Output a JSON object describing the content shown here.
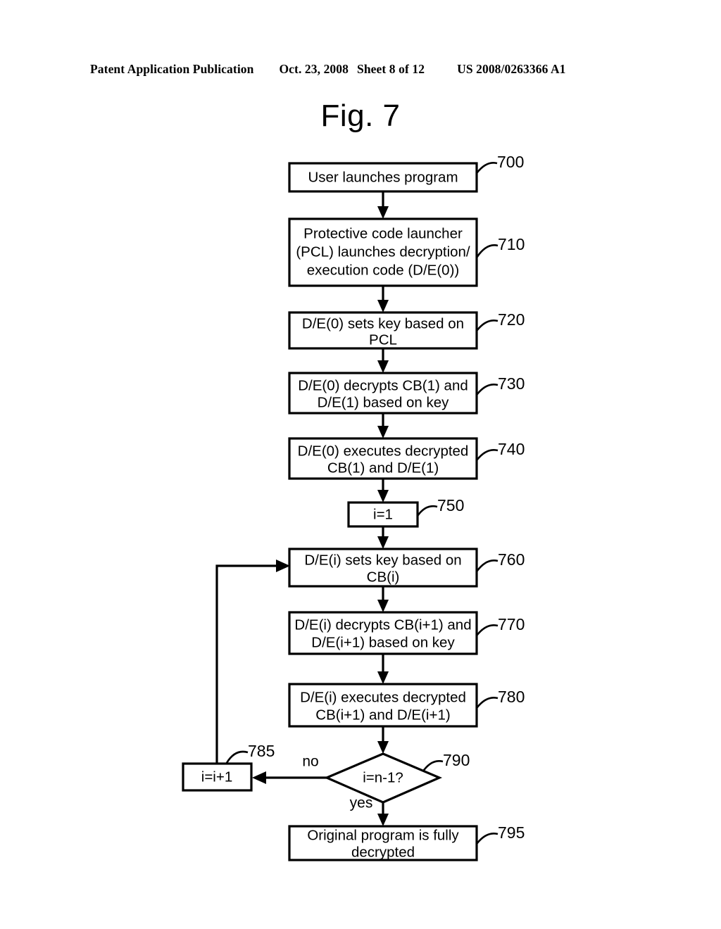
{
  "header": {
    "publication": "Patent Application Publication",
    "date": "Oct. 23, 2008",
    "sheet": "Sheet 8 of 12",
    "patent_number": "US 2008/0263366 A1"
  },
  "figure": {
    "title": "Fig. 7",
    "type": "flowchart"
  },
  "flowchart": {
    "nodes": [
      {
        "id": "700",
        "ref": "700",
        "shape": "rect",
        "lines": [
          "User launches program"
        ]
      },
      {
        "id": "710",
        "ref": "710",
        "shape": "rect",
        "lines": [
          "Protective code launcher",
          "(PCL) launches decryption/",
          "execution code (D/E(0))"
        ]
      },
      {
        "id": "720",
        "ref": "720",
        "shape": "rect",
        "lines": [
          "D/E(0) sets key based on",
          "PCL"
        ]
      },
      {
        "id": "730",
        "ref": "730",
        "shape": "rect",
        "lines": [
          "D/E(0) decrypts CB(1) and",
          "D/E(1) based on key"
        ]
      },
      {
        "id": "740",
        "ref": "740",
        "shape": "rect",
        "lines": [
          "D/E(0) executes decrypted",
          "CB(1) and D/E(1)"
        ]
      },
      {
        "id": "750",
        "ref": "750",
        "shape": "rect",
        "lines": [
          "i=1"
        ]
      },
      {
        "id": "760",
        "ref": "760",
        "shape": "rect",
        "lines": [
          "D/E(i) sets key based on",
          "CB(i)"
        ]
      },
      {
        "id": "770",
        "ref": "770",
        "shape": "rect",
        "lines": [
          "D/E(i) decrypts CB(i+1) and",
          "D/E(i+1) based on key"
        ]
      },
      {
        "id": "780",
        "ref": "780",
        "shape": "rect",
        "lines": [
          "D/E(i) executes decrypted",
          "CB(i+1) and D/E(i+1)"
        ]
      },
      {
        "id": "785",
        "ref": "785",
        "shape": "rect",
        "lines": [
          "i=i+1"
        ]
      },
      {
        "id": "790",
        "ref": "790",
        "shape": "diamond",
        "lines": [
          "i=n-1?"
        ]
      },
      {
        "id": "795",
        "ref": "795",
        "shape": "rect",
        "lines": [
          "Original program is fully",
          "decrypted"
        ]
      }
    ],
    "edge_labels": {
      "no": "no",
      "yes": "yes"
    },
    "colors": {
      "stroke": "#000000",
      "fill": "#ffffff",
      "text": "#000000"
    }
  }
}
